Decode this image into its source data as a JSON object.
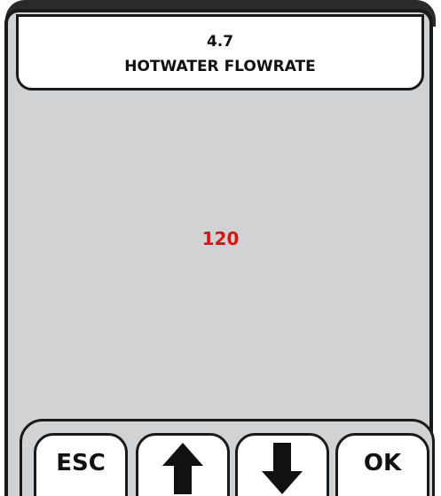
{
  "header": {
    "number": "4.7",
    "title": "HOTWATER FLOWRATE"
  },
  "main": {
    "value": "120",
    "value_color": "#e01010"
  },
  "buttons": {
    "esc_label": "ESC",
    "up_icon": "arrow-up-icon",
    "down_icon": "arrow-down-icon",
    "ok_label": "OK"
  }
}
